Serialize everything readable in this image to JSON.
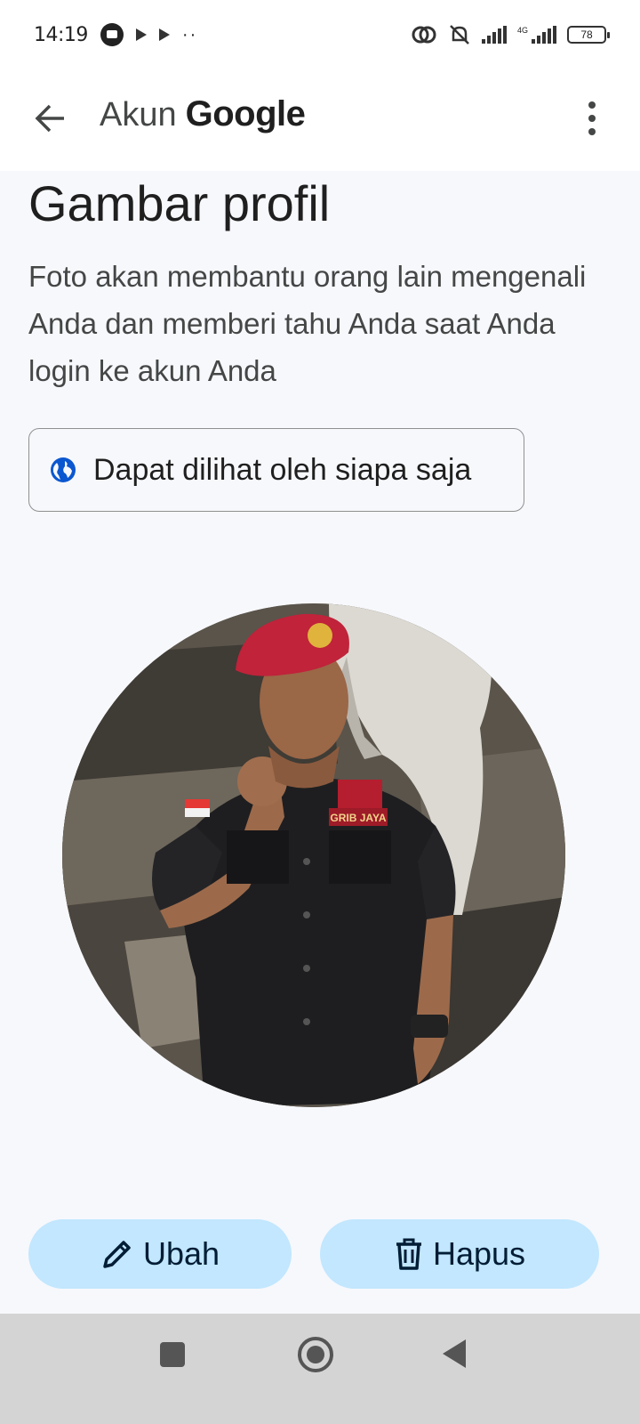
{
  "status_bar": {
    "time": "14:19",
    "battery": "78",
    "network": "4G"
  },
  "app_bar": {
    "title_prefix": "Akun",
    "title_brand": "Google"
  },
  "profile_picture": {
    "heading": "Gambar profil",
    "description": "Foto akan membantu orang lain mengenali Anda dan memberi tahu Anda saat Anda login ke akun Anda",
    "visibility_label": "Dapat dilihat oleh siapa saja",
    "photo_badge_text": "GRIB JAYA"
  },
  "actions": {
    "edit_label": "Ubah",
    "delete_label": "Hapus"
  },
  "colors": {
    "accent_button": "#c2e7ff",
    "globe_icon": "#0b57d0",
    "background": "#f7f8fc"
  },
  "icons": {
    "back": "arrow-left-icon",
    "more": "more-vert-icon",
    "visibility": "globe-icon",
    "edit": "pencil-icon",
    "delete": "trash-icon"
  }
}
